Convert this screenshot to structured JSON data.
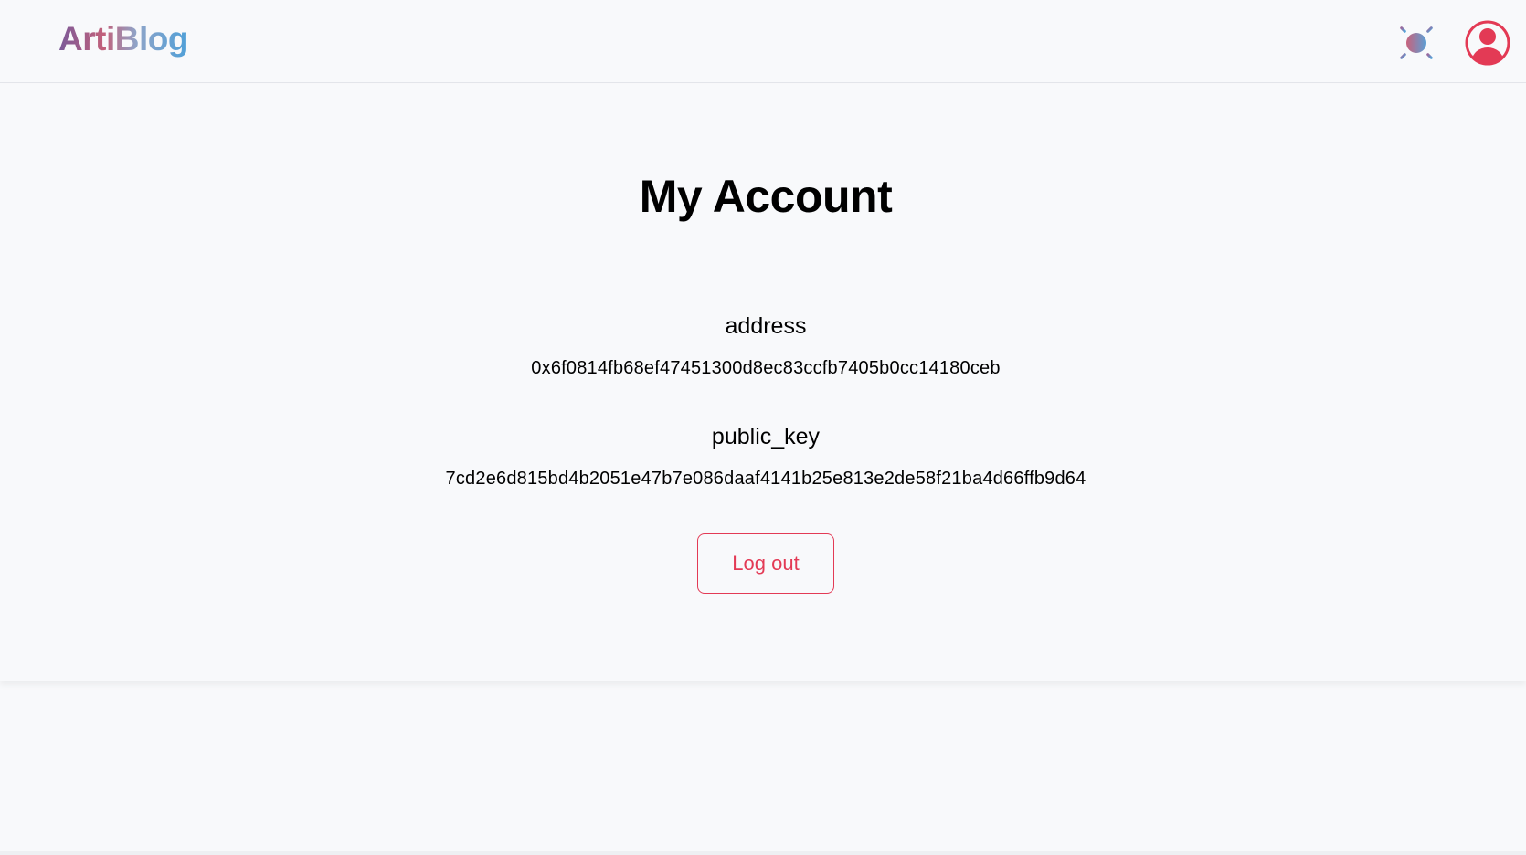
{
  "header": {
    "logo_text": "ArtiBlog",
    "theme_toggle_icon": "sun-icon",
    "avatar_icon": "user-icon",
    "accent_color": "#e33a55"
  },
  "main": {
    "title": "My Account",
    "fields": [
      {
        "label": "address",
        "value": "0x6f0814fb68ef47451300d8ec83ccfb7405b0cc14180ceb"
      },
      {
        "label": "public_key",
        "value": "7cd2e6d815bd4b2051e47b7e086daaf4141b25e813e2de58f21ba4d66ffb9d64"
      }
    ],
    "logout_label": "Log out"
  }
}
